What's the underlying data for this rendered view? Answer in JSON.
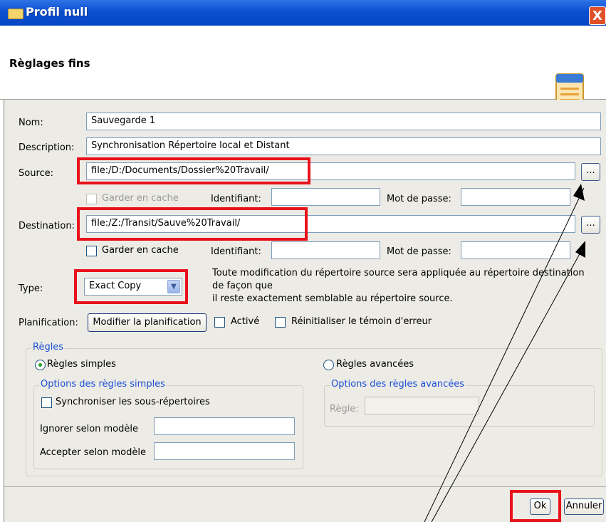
{
  "window": {
    "title": "Profil null",
    "close_glyph": "X"
  },
  "header": {
    "title": "Règlages fins",
    "icon": "document-list-icon"
  },
  "form": {
    "name_label": "Nom:",
    "name_value": "Sauvegarde 1",
    "description_label": "Description:",
    "description_value": "Synchronisation Répertoire local et Distant",
    "source_label": "Source:",
    "source_value": "file:/D:/Documents/Dossier%20Travail/",
    "browse_label": "...",
    "source_cache_label": "Garder en cache",
    "identifiant_label": "Identifiant:",
    "password_label": "Mot de passe:",
    "destination_label": "Destination:",
    "destination_value": "file:/Z:/Transit/Sauve%20Travail/",
    "dest_cache_label": "Garder en cache",
    "type_label": "Type:",
    "type_value": "Exact Copy",
    "type_desc_1": "Toute modification du répertoire source sera appliquée au répertoire destination",
    "type_desc_2": "de façon que",
    "type_desc_3": "il reste exactement semblable au répertoire source.",
    "planification_label": "Planification:",
    "planification_button": "Modifier la planification",
    "active_label": "Activé",
    "reset_label": "Réinitialiser le témoin d'erreur"
  },
  "rules": {
    "legend": "Règles",
    "simple_label": "Règles simples",
    "advanced_label": "Règles avancées",
    "simple_options_legend": "Options des règles simples",
    "sync_subdirs_label": "Synchroniser les sous-répertoires",
    "ignore_label": "Ignorer selon modèle",
    "accept_label": "Accepter selon modèle",
    "advanced_options_legend": "Options des règles avancées",
    "rule_label": "Règle:"
  },
  "footer": {
    "ok_label": "Ok",
    "cancel_label": "Annuler"
  },
  "colors": {
    "highlight": "#e8121b",
    "titlebar": "#0a4fd0",
    "legend": "#1e50d6"
  }
}
